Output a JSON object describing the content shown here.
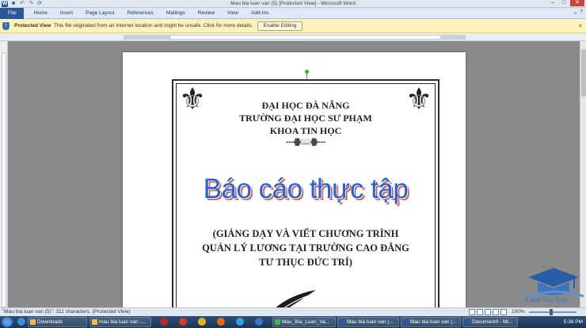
{
  "window": {
    "title": "Mau bia luan van (5) [Protected View]  -  Microsoft Word",
    "minimize": "–",
    "maximize": "□",
    "close": "✕"
  },
  "qat": {
    "save": "■",
    "undo": "↶",
    "redo": "↷",
    "refresh": "⟳"
  },
  "ribbon": {
    "tabs": [
      "File",
      "Home",
      "Insert",
      "Page Layout",
      "References",
      "Mailings",
      "Review",
      "View",
      "Add-Ins"
    ],
    "minimize": "▵",
    "help": "?"
  },
  "protected_view": {
    "title": "Protected View",
    "message": "This file originated from an Internet location and might be unsafe. Click for more details.",
    "button": "Enable Editing",
    "close": "×"
  },
  "document": {
    "line1": "ĐẠI HỌC ĐÀ NẴNG",
    "line2": "TRƯỜNG ĐẠI HỌC SƯ PHẠM",
    "line3": "KHOA TIN HỌC",
    "divider": "---ꙮ📖ꙮ---",
    "big_title": "Báo cáo thực tập",
    "sub1": "(GIẢNG DẠY VÀ VIẾT CHƯƠNG TRÌNH",
    "sub2": "QUẢN LÝ LƯƠNG TẠI TRƯỜNG CAO ĐẲNG",
    "sub3": "TƯ THỤC ĐỨC TRÍ)",
    "ornament": "⚜"
  },
  "watermark": {
    "text": "Luan Van Viet"
  },
  "statusbar": {
    "text": "\"Mau bia luan van (5)\": 311 characters.  (Protected View)",
    "zoom": "100%"
  },
  "taskbar": {
    "items": [
      {
        "label": "Downloads",
        "color": "#e6c040"
      },
      {
        "label": "mau bia luan van -...",
        "color": "#e6c040"
      },
      {
        "label": "Mau_Bia_Luan_Va...",
        "color": "#4caf50"
      },
      {
        "label": "Mau bia luan van (...",
        "color": "#2b579a"
      },
      {
        "label": "Mau bia luan van (...",
        "color": "#2b579a"
      },
      {
        "label": "Document4 - Mi...",
        "color": "#2b579a"
      }
    ],
    "time": "5:38 PM"
  }
}
